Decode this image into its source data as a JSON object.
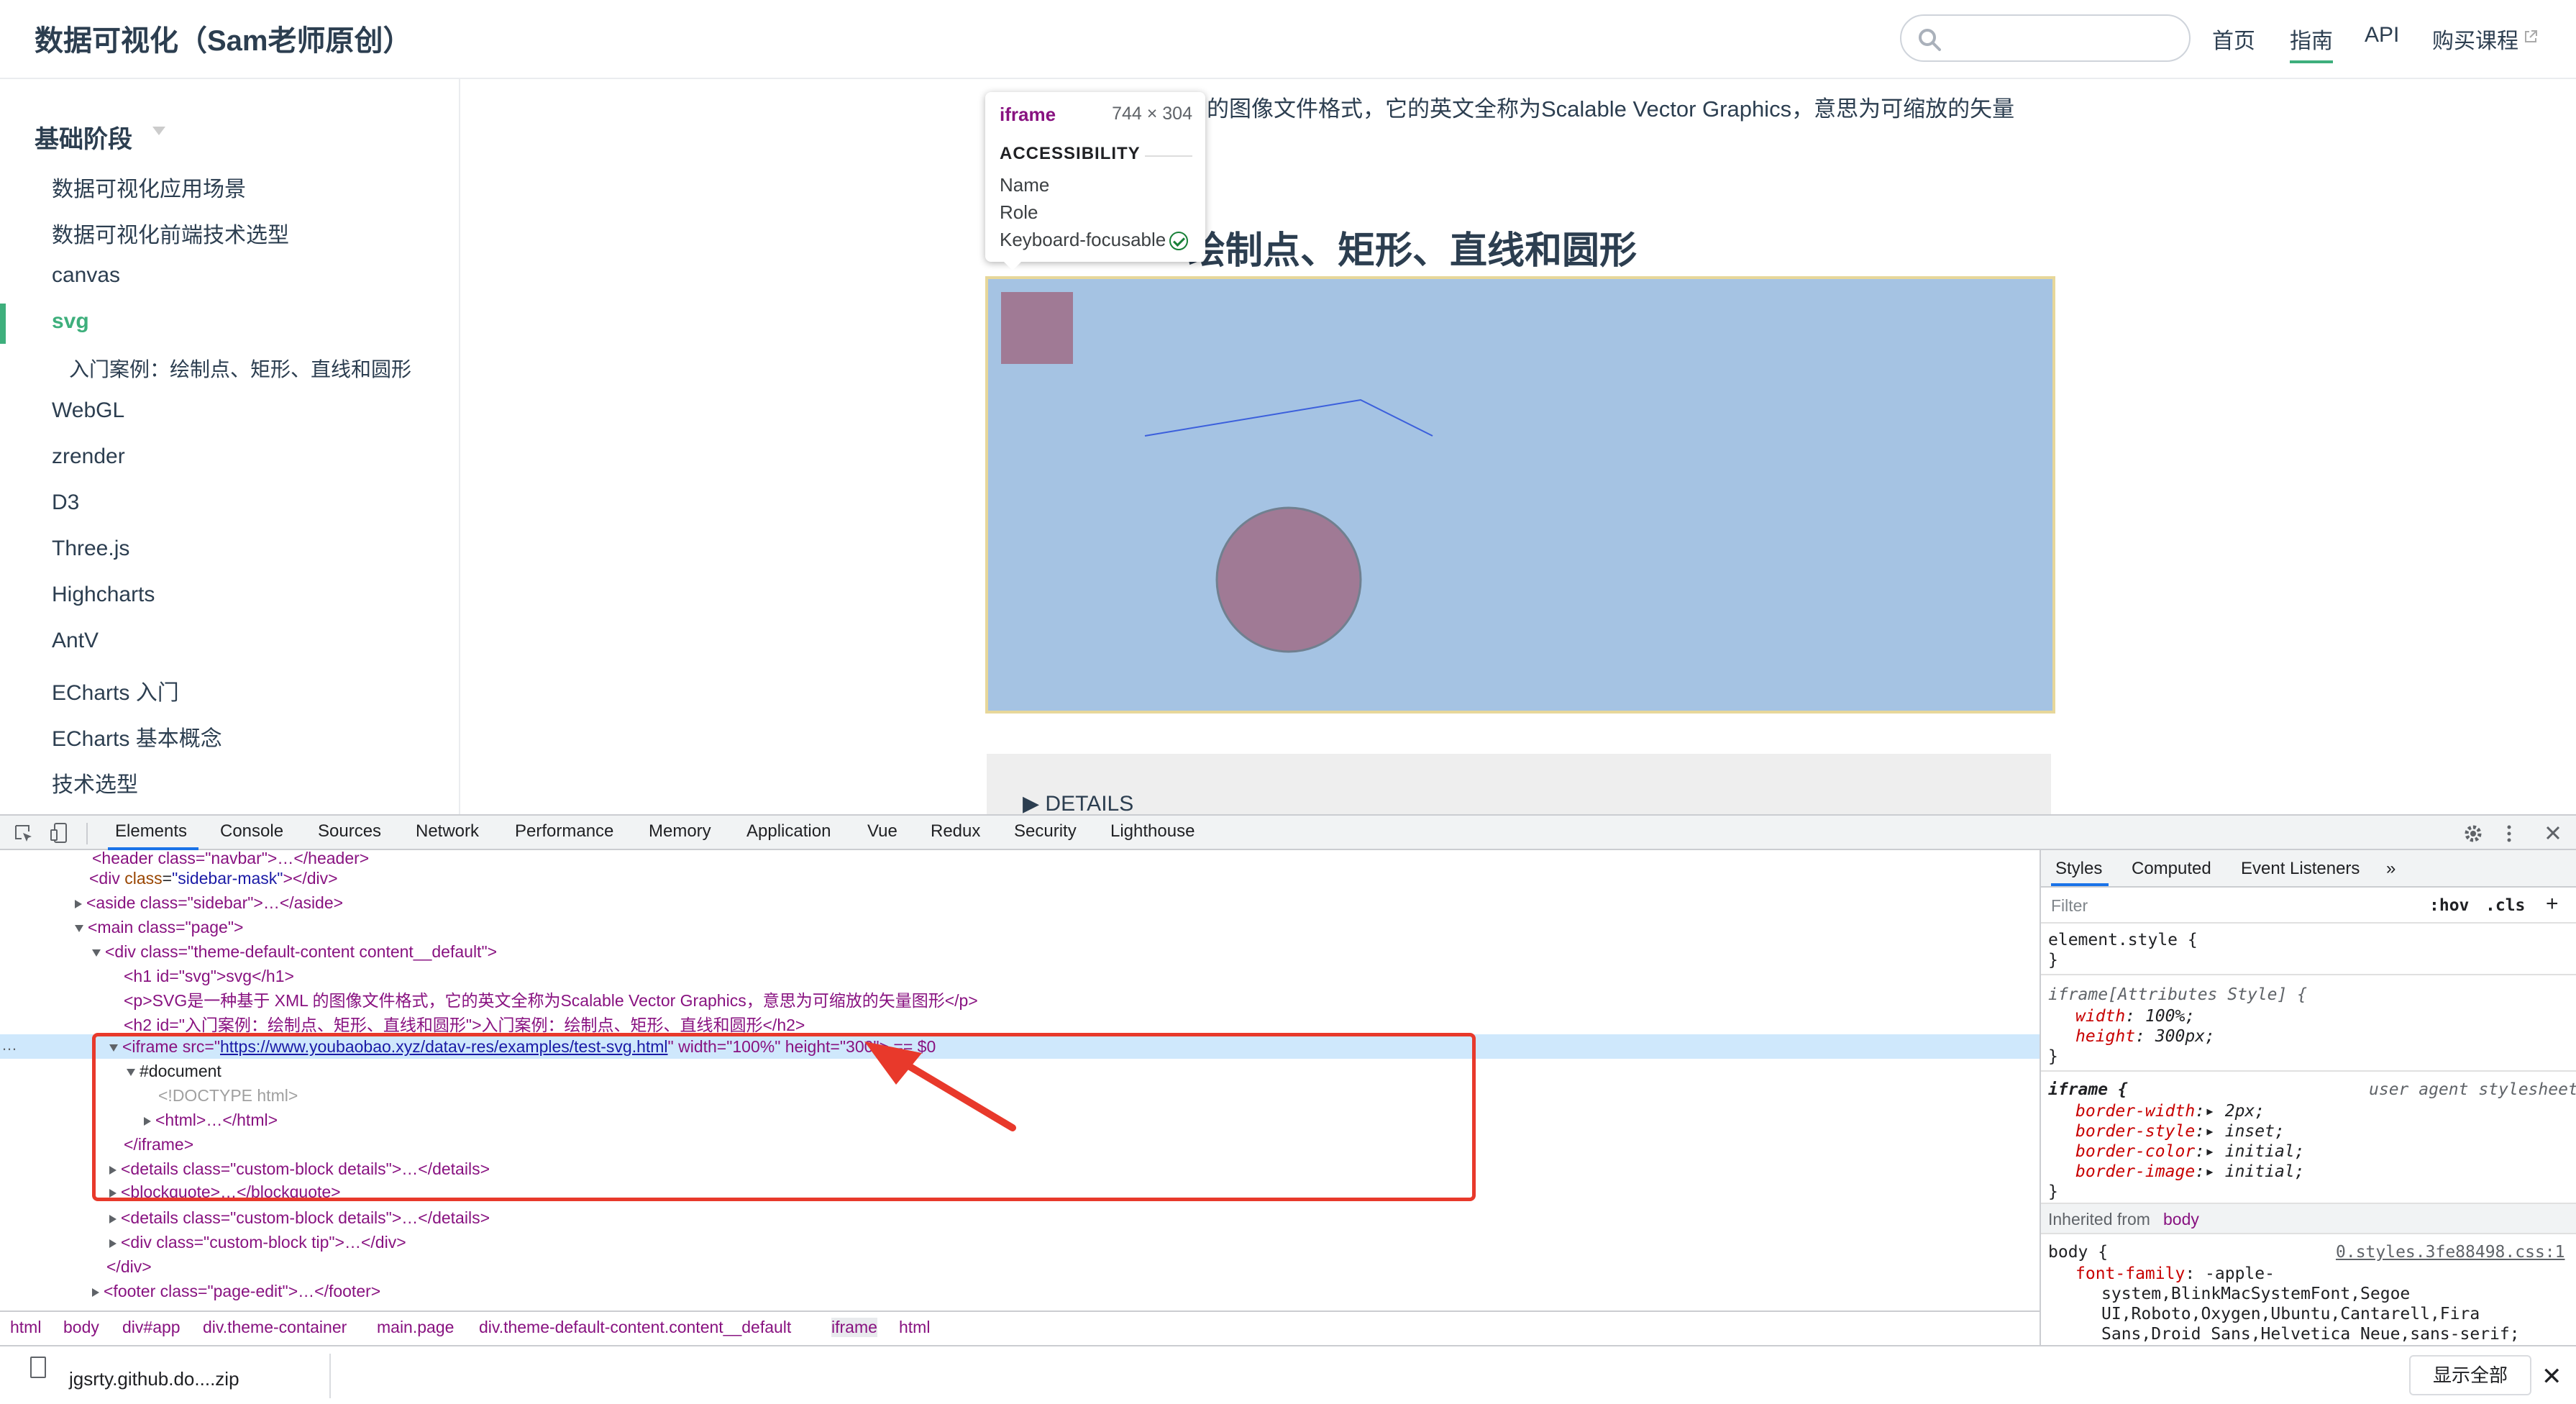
{
  "navbar": {
    "title": "数据可视化（Sam老师原创）",
    "search_placeholder": "",
    "links": [
      "首页",
      "指南",
      "API",
      "购买课程"
    ],
    "external_icon": "external-link-icon"
  },
  "sidebar": {
    "heading": "基础阶段",
    "items": [
      "数据可视化应用场景",
      "数据可视化前端技术选型",
      "canvas",
      "svg",
      "入门案例：绘制点、矩形、直线和圆形",
      "WebGL",
      "zrender",
      "D3",
      "Three.js",
      "Highcharts",
      "AntV",
      "ECharts 入门",
      "ECharts 基本概念",
      "技术选型"
    ],
    "active_item": "svg"
  },
  "content": {
    "paragraph_fragment": "的图像文件格式，它的英文全称为Scalable Vector Graphics，意思为可缩放的矢量",
    "h2_fragment": "绘制点、矩形、直线和圆形",
    "details_label": "▶ DETAILS"
  },
  "tooltip": {
    "tag": "iframe",
    "size": "744 × 304",
    "section": "ACCESSIBILITY",
    "rows": [
      "Name",
      "Role",
      "Keyboard-focusable"
    ]
  },
  "devtools": {
    "tabs": [
      "Elements",
      "Console",
      "Sources",
      "Network",
      "Performance",
      "Memory",
      "Application",
      "Vue",
      "Redux",
      "Security",
      "Lighthouse"
    ],
    "active_tab": "Elements",
    "dom": {
      "header": "<header class=\"navbar\">…</header>",
      "sidebar_mask_open": "<div ",
      "sidebar_mask_attr": "class",
      "sidebar_mask_val": "\"sidebar-mask\"",
      "sidebar_mask_close": "></div>",
      "aside": "<aside class=\"sidebar\">…</aside>",
      "main": "<main class=\"page\">",
      "div_content": "<div class=\"theme-default-content content__default\">",
      "h1": "<h1 id=\"svg\">svg</h1>",
      "p": "<p>SVG是一种基于 XML 的图像文件格式，它的英文全称为Scalable Vector Graphics，意思为可缩放的矢量图形</p>",
      "h2": "<h2 id=\"入门案例：绘制点、矩形、直线和圆形\">入门案例：绘制点、矩形、直线和圆形</h2>",
      "iframe_open": "<iframe src=\"",
      "iframe_src": "https://www.youbaobao.xyz/datav-res/examples/test-svg.html",
      "iframe_rest": "\" width=\"100%\" height=\"300\"> == $0",
      "document": "#document",
      "doctype": "<!DOCTYPE html>",
      "html": "<html>…</html>",
      "iframe_close": "</iframe>",
      "details1": "<details class=\"custom-block details\">…</details>",
      "blockquote": "<blockquote>…</blockquote>",
      "details2": "<details class=\"custom-block details\">…</details>",
      "tip": "<div class=\"custom-block tip\">…</div>",
      "div_close": "</div>",
      "footer": "<footer class=\"page-edit\">…</footer>"
    },
    "breadcrumbs": [
      "html",
      "body",
      "div#app",
      "div.theme-container",
      "main.page",
      "div.theme-default-content.content__default",
      "iframe",
      "html"
    ],
    "styles_tabs": [
      "Styles",
      "Computed",
      "Event Listeners",
      "»"
    ],
    "filter_placeholder": "Filter",
    "hov": ":hov",
    "cls": ".cls",
    "plus": "+",
    "element_style_open": "element.style {",
    "brace_close": "}",
    "attr_style": "iframe[Attributes Style] {",
    "width_prop": "width",
    "width_val": "100%;",
    "height_prop": "height",
    "height_val": "300px;",
    "ua_selector": "iframe {",
    "ua_label": "user agent stylesheet",
    "ua_props": [
      {
        "name": "border-width",
        "value": "2px;"
      },
      {
        "name": "border-style",
        "value": "inset;"
      },
      {
        "name": "border-color",
        "value": "initial;"
      },
      {
        "name": "border-image",
        "value": "initial;"
      }
    ],
    "inherited_label": "Inherited from",
    "inherited_from": "body",
    "body_selector": "body {",
    "body_source": "0.styles.3fe88498.css:1",
    "font_family_prop": "font-family",
    "font_family_lines": [
      "-apple-",
      "system,BlinkMacSystemFont,Segoe",
      "UI,Roboto,Oxygen,Ubuntu,Cantarell,Fira",
      "Sans,Droid Sans,Helvetica Neue,sans-serif;"
    ]
  },
  "downloads": {
    "file_name": "jgsrty.github.do....zip",
    "show_all": "显示全部",
    "close": "✕"
  },
  "colors": {
    "accent": "#3eaf7c",
    "iframe_bg": "#a5c3e3",
    "shape_fill": "#a07a95",
    "line_color": "#3b5fdc",
    "highlight": "#e8392b"
  }
}
